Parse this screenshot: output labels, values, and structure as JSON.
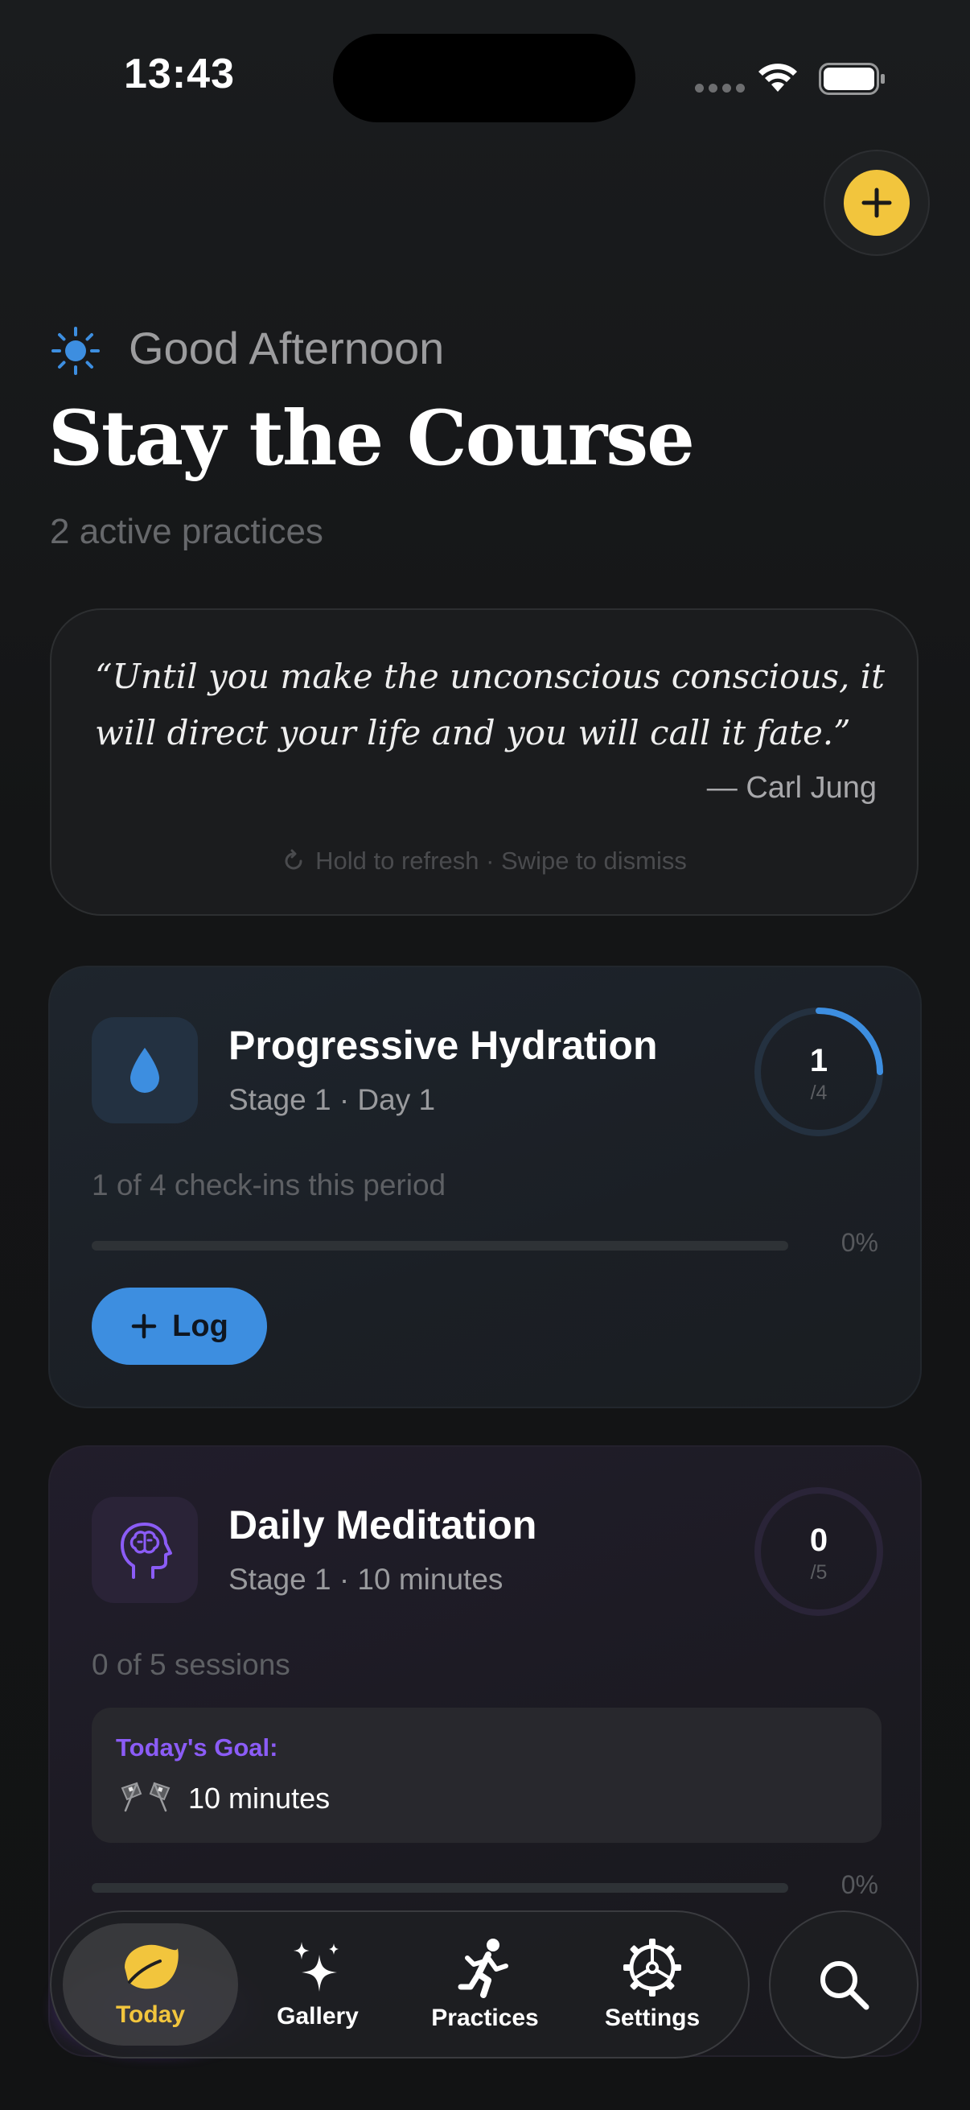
{
  "status_bar": {
    "time": "13:43"
  },
  "header": {
    "add_button_icon": "plus-icon",
    "greeting_icon": "sun-icon",
    "greeting": "Good Afternoon",
    "title": "Stay the Course",
    "subtitle": "2 active practices"
  },
  "quote": {
    "text": "“Until you make the unconscious conscious, it will direct your life and you will call it fate.”",
    "author": "— Carl Jung",
    "hint": "Hold to refresh · Swipe to dismiss",
    "hint_icon": "refresh-icon"
  },
  "practices": [
    {
      "name": "Progressive Hydration",
      "detail": "Stage 1 · Day 1",
      "icon": "water-drop-icon",
      "ring_value": "1",
      "ring_total": "/4",
      "ring_progress": 0.25,
      "count_text": "1 of 4 check-ins this period",
      "bar_progress": 0,
      "percent": "0%",
      "action_label": "Log",
      "accent": "#3d8ee0"
    },
    {
      "name": "Daily Meditation",
      "detail": "Stage 1 · 10 minutes",
      "icon": "brain-head-icon",
      "ring_value": "0",
      "ring_total": "/5",
      "ring_progress": 0,
      "count_text": "0 of 5 sessions",
      "goal_label": "Today's Goal:",
      "goal_icon": "checkered-flags-icon",
      "goal_value": "10 minutes",
      "bar_progress": 0,
      "percent": "0%",
      "accent": "#8b5cf6"
    }
  ],
  "tabbar": {
    "tabs": [
      {
        "label": "Today",
        "icon": "leaf-icon",
        "active": true
      },
      {
        "label": "Gallery",
        "icon": "sparkles-icon",
        "active": false
      },
      {
        "label": "Practices",
        "icon": "running-figure-icon",
        "active": false
      },
      {
        "label": "Settings",
        "icon": "gear-icon",
        "active": false
      }
    ],
    "search_icon": "search-icon"
  },
  "colors": {
    "background": "#141516",
    "accent_yellow": "#f2c53d",
    "hydration_blue": "#3d8ee0",
    "meditation_purple": "#8b5cf6"
  }
}
